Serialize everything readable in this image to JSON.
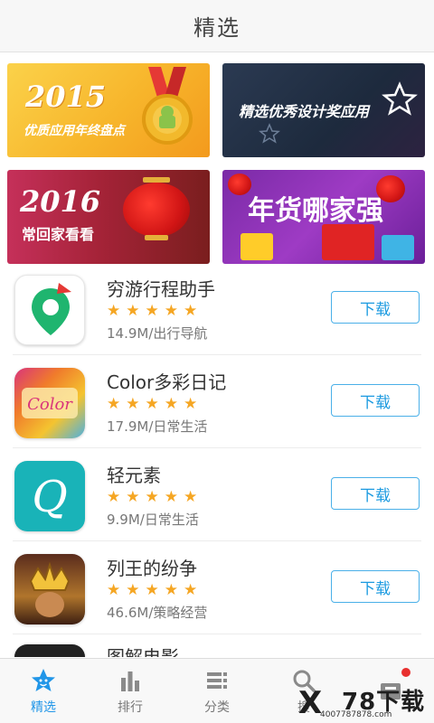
{
  "header": {
    "title": "精选"
  },
  "banners": [
    {
      "big": "2015",
      "sub": "优质应用年终盘点",
      "color": "#f7b52b"
    },
    {
      "sub": "精选优秀设计奖应用",
      "color": "#1d2a3d"
    },
    {
      "big": "2016",
      "sub": "常回家看看",
      "color": "#a52338"
    },
    {
      "sub": "年货哪家强",
      "color": "#9e3bc4"
    }
  ],
  "apps": [
    {
      "name": "穷游行程助手",
      "stars": "★★★★★",
      "meta": "14.9M/出行导航",
      "button": "下载",
      "icon": "location-pin-icon"
    },
    {
      "name": "Color多彩日记",
      "stars": "★★★★★",
      "meta": "17.9M/日常生活",
      "button": "下载",
      "icon": "color-diary-icon"
    },
    {
      "name": "轻元素",
      "stars": "★★★★★",
      "meta": "9.9M/日常生活",
      "button": "下载",
      "icon": "letter-q-icon"
    },
    {
      "name": "列王的纷争",
      "stars": "★★★★★",
      "meta": "46.6M/策略经营",
      "button": "下载",
      "icon": "king-crown-icon"
    }
  ],
  "partial_app": {
    "name": "图解电影"
  },
  "tabs": [
    {
      "label": "精选",
      "icon": "star-face-icon",
      "active": true
    },
    {
      "label": "排行",
      "icon": "bar-chart-icon"
    },
    {
      "label": "分类",
      "icon": "list-icon"
    },
    {
      "label": "搜",
      "icon": "search-icon"
    },
    {
      "label": "",
      "icon": "box-icon",
      "badge": true
    }
  ],
  "watermark": {
    "logo": "X",
    "text": "78下载",
    "url": "4007787878.com"
  },
  "colors": {
    "accent": "#2196e8",
    "star": "#f5a623",
    "badge": "#e8302f"
  }
}
